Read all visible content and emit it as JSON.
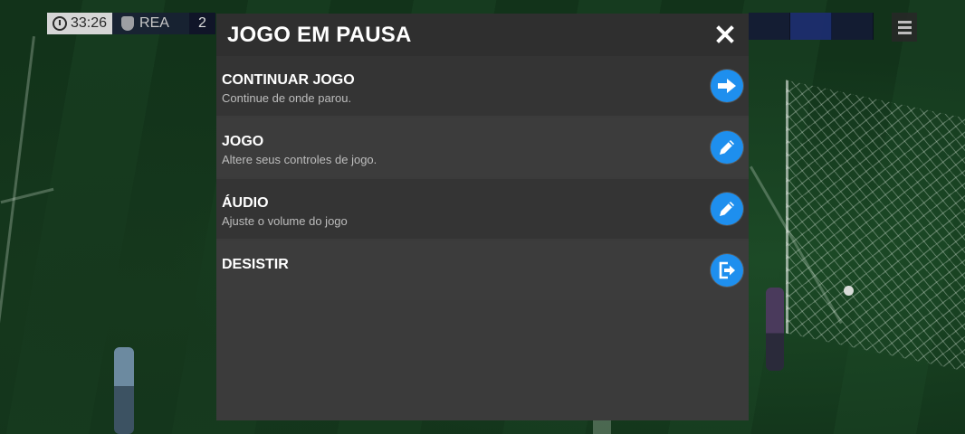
{
  "hud": {
    "clock": "33:26",
    "team": "REA",
    "score": "2"
  },
  "pause_menu": {
    "title": "JOGO EM PAUSA",
    "close_icon": "close-icon",
    "items": [
      {
        "title": "CONTINUAR JOGO",
        "description": "Continue de onde parou.",
        "icon": "arrow-right-icon"
      },
      {
        "title": "JOGO",
        "description": "Altere seus controles de jogo.",
        "icon": "pencil-icon"
      },
      {
        "title": "ÁUDIO",
        "description": "Ajuste o volume do jogo",
        "icon": "pencil-icon"
      },
      {
        "title": "DESISTIR",
        "description": "",
        "icon": "exit-icon"
      }
    ]
  },
  "colors": {
    "accent": "#1e8fee",
    "panel": "#3b3b3b",
    "header": "#2f2f2f"
  }
}
